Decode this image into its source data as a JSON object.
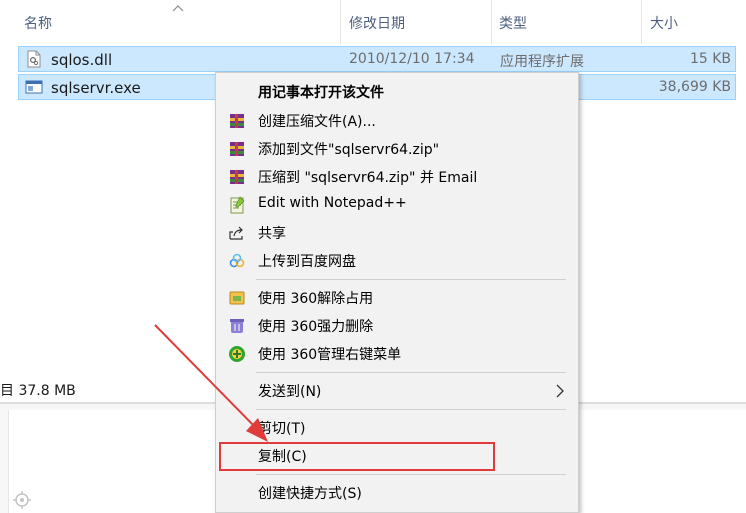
{
  "columns": {
    "name": "名称",
    "modified": "修改日期",
    "type": "类型",
    "size": "大小"
  },
  "files": [
    {
      "name": "sqlos.dll",
      "modified": "2010/12/10 17:34",
      "type": "应用程序扩展",
      "size": "15 KB",
      "icon": "dll-file-icon"
    },
    {
      "name": "sqlservr.exe",
      "modified": "",
      "type": "",
      "size": "38,699 KB",
      "icon": "exe-file-icon"
    }
  ],
  "status": {
    "text": "目 37.8 MB"
  },
  "context_menu": {
    "items": [
      {
        "label": "用记事本打开该文件",
        "icon": "",
        "bold": true
      },
      {
        "label": "创建压缩文件(A)...",
        "icon": "winrar-icon"
      },
      {
        "label": "添加到文件\"sqlservr64.zip\"",
        "icon": "winrar-icon"
      },
      {
        "label": "压缩到 \"sqlservr64.zip\" 并 Email",
        "icon": "winrar-icon"
      },
      {
        "label": "Edit with Notepad++",
        "icon": "notepad-plus-plus-icon"
      },
      {
        "label": "共享",
        "icon": "share-icon"
      },
      {
        "label": "上传到百度网盘",
        "icon": "baidu-netdisk-icon"
      },
      {
        "label": "使用 360解除占用",
        "icon": "360-unlock-icon"
      },
      {
        "label": "使用 360强力删除",
        "icon": "360-delete-icon"
      },
      {
        "label": "使用 360管理右键菜单",
        "icon": "360-manage-icon"
      },
      {
        "label": "发送到(N)",
        "icon": ""
      },
      {
        "label": "剪切(T)",
        "icon": ""
      },
      {
        "label": "复制(C)",
        "icon": ""
      },
      {
        "label": "创建快捷方式(S)",
        "icon": ""
      }
    ]
  },
  "colors": {
    "selection": "#cce8ff",
    "highlight_box": "#e03c3c",
    "arrow": "#e03c3c"
  }
}
